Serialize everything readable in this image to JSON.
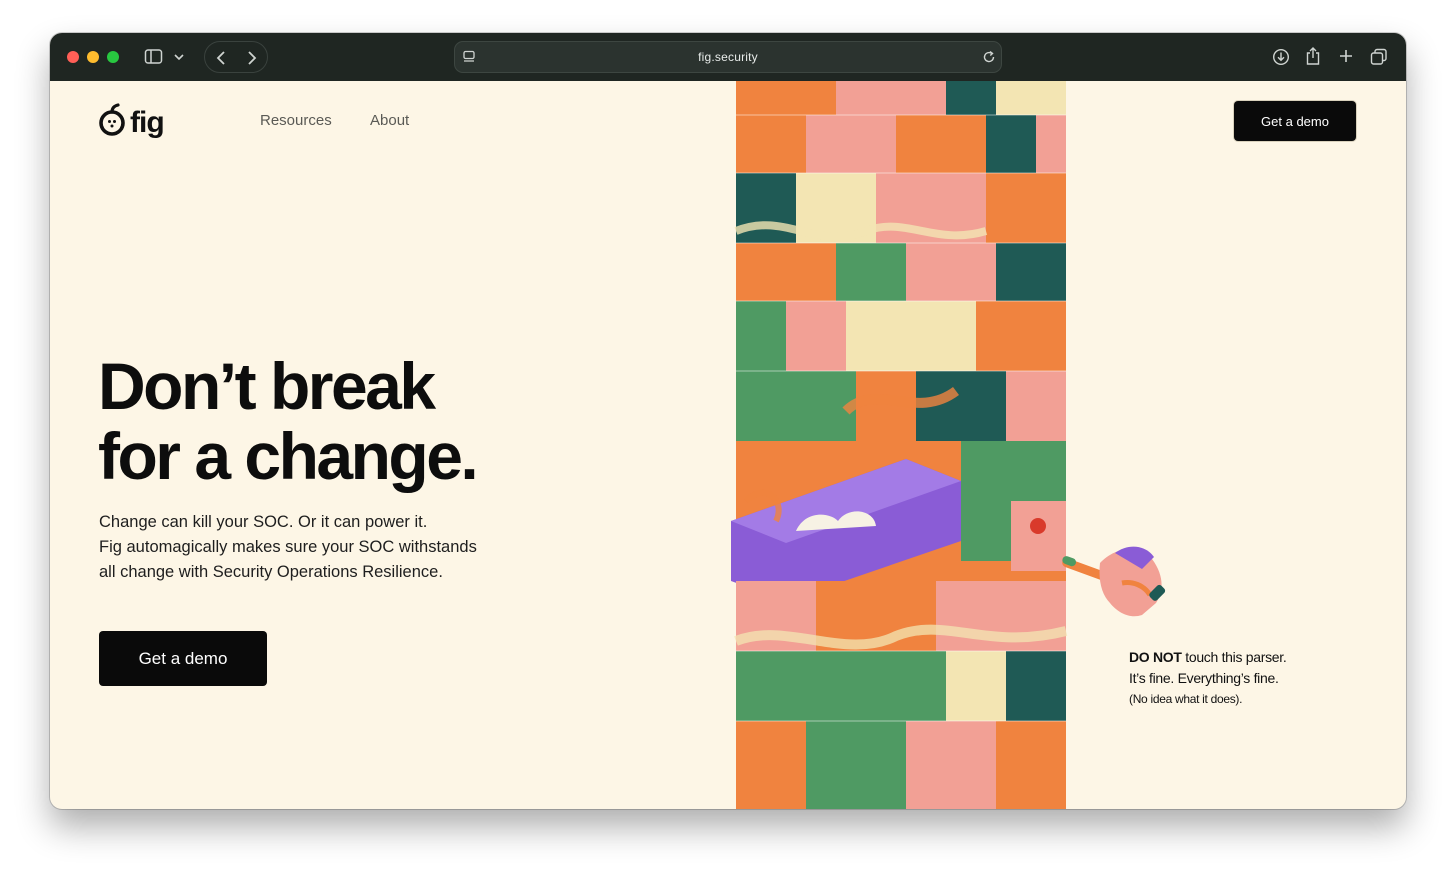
{
  "browser": {
    "url": "fig.security",
    "icons": [
      "sidebar-icon",
      "chevron-down-icon",
      "back-icon",
      "forward-icon",
      "page-settings-icon",
      "reload-icon",
      "download-icon",
      "share-icon",
      "new-tab-icon",
      "tabs-overview-icon"
    ]
  },
  "header": {
    "logo_text": "fig",
    "nav": [
      "Resources",
      "About"
    ],
    "cta_label": "Get a demo"
  },
  "hero": {
    "headline_line1": "Don’t break",
    "headline_line2": "for a change.",
    "subcopy_line1": "Change can kill your SOC. Or it can power it.",
    "subcopy_line2": "Fig automagically makes sure your SOC withstands",
    "subcopy_line3": "all change with Security Operations Resilience.",
    "cta_label": "Get a demo"
  },
  "illustration": {
    "caption_bold": "DO NOT",
    "caption_rest": " touch this parser.",
    "caption_line2": "It’s fine. Everything’s fine.",
    "caption_line3": "(No idea what it does)."
  },
  "colors": {
    "page_bg": "#fdf6e6",
    "titlebar_bg": "#1f2622",
    "button_bg": "#0a0a0a",
    "block_orange": "#f0833f",
    "block_pink": "#f2a095",
    "block_green": "#4f9a63",
    "block_teal": "#1f5a55",
    "block_purple": "#8a5cd6",
    "block_cream": "#f3e5b3"
  }
}
